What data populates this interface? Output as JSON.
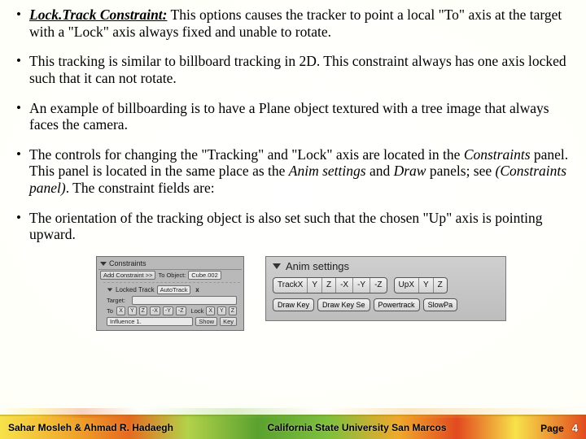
{
  "bullets": {
    "b1_term": "Lock.Track Constraint:",
    "b1_rest": " This options causes the tracker to point a local \"To\" axis at the target with a \"Lock\" axis always fixed and unable to rotate.",
    "b2": "This tracking is similar to billboard tracking in 2D. This constraint always has one axis locked such that it can not rotate.",
    "b3": "An example of billboarding is to have a Plane object textured with a tree image that always faces the camera.",
    "b4_a": "The controls for changing the \"Tracking\" and \"Lock\" axis are located in the ",
    "b4_constraints": "Constraints",
    "b4_b": " panel. This panel is located in the same place as the ",
    "b4_anim": "Anim settings",
    "b4_c": " and ",
    "b4_draw": "Draw",
    "b4_d": " panels; see ",
    "b4_ref": "(Constraints panel)",
    "b4_e": ". The constraint fields are:",
    "b5": "The orientation of the tracking object is also set such that the chosen \"Up\" axis is pointing upward."
  },
  "panelA": {
    "header": "Constraints",
    "add_label": "Add Constraint >>",
    "to_object": "To Object:",
    "to_value": "Cube.002",
    "constraint_type": "Locked Track",
    "constraint_name": "AutoTrack",
    "target_label": "Target:",
    "target_value": "",
    "to_row_label": "To",
    "to_buttons": [
      "X",
      "Y",
      "Z",
      "-X",
      "-Y",
      "-Z"
    ],
    "lock_label": "Lock",
    "lock_buttons": [
      "X",
      "Y",
      "Z"
    ],
    "show_btn": "Show",
    "key_btn": "Key",
    "influence_label": "Influence 1.",
    "x_close": "x"
  },
  "panelB": {
    "header": "Anim settings",
    "group1": [
      "TrackX",
      "Y",
      "Z",
      "-X",
      "-Y",
      "-Z"
    ],
    "group2": [
      "UpX",
      "Y",
      "Z"
    ],
    "row2": [
      "Draw Key",
      "Draw Key Se",
      "Powertrack",
      "SlowPa"
    ]
  },
  "footer": {
    "authors": "Sahar Mosleh & Ahmad R. Hadaegh",
    "uni": "California State University San Marcos",
    "page_label": "Page",
    "page_num": "4"
  }
}
